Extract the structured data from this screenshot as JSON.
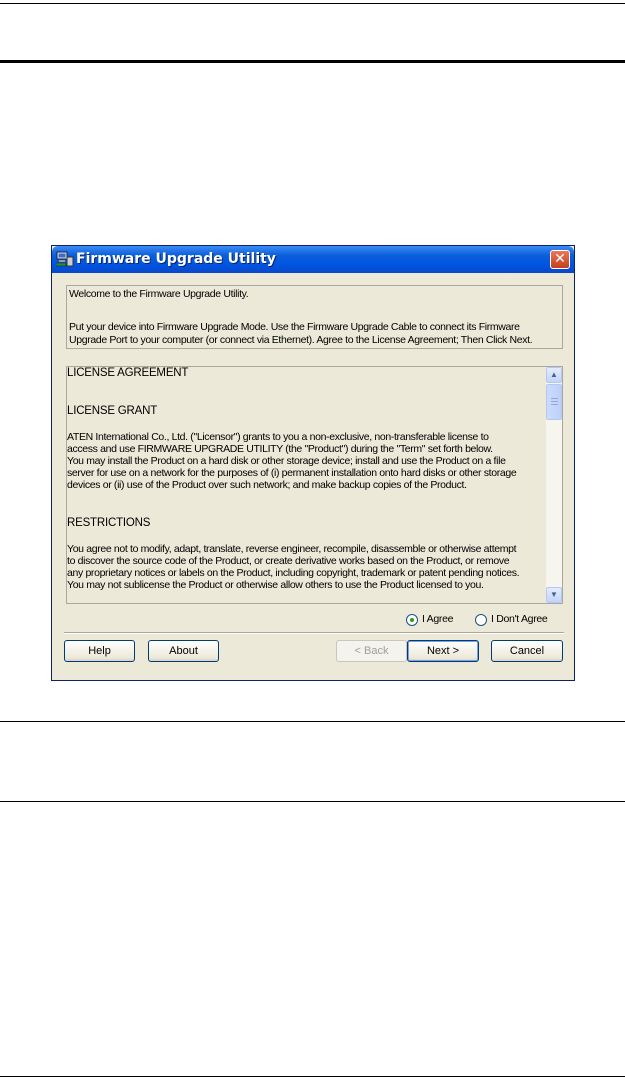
{
  "window": {
    "title": "Firmware Upgrade Utility",
    "close_symbol": "✕"
  },
  "welcome": {
    "line1": "Welcome to the Firmware Upgrade Utility.",
    "line2": "Put your device into Firmware Upgrade Mode. Use the Firmware Upgrade Cable to connect its Firmware",
    "line3": "Upgrade Port to your computer (or connect via Ethernet). Agree to the License Agreement; Then Click Next."
  },
  "license": {
    "heading": "LICENSE AGREEMENT",
    "grant_heading": "LICENSE GRANT",
    "grant_lines": [
      "ATEN International Co., Ltd. (\"Licensor\") grants to you a non-exclusive, non-transferable license to",
      "access and use FIRMWARE UPGRADE UTILITY (the \"Product\") during the \"Term\" set forth below.",
      "You may install the Product on a hard disk or other storage device; install and use the Product on a file",
      "server for use on a network for the purposes of (i) permanent installation onto hard disks or other storage",
      "devices or (ii) use of the Product over such network; and make backup copies of the Product."
    ],
    "restrictions_heading": "RESTRICTIONS",
    "restriction_lines": [
      "You agree not to modify, adapt, translate, reverse engineer, recompile, disassemble or otherwise attempt",
      "to discover the source code of the Product, or create derivative works based on the Product, or remove",
      "any proprietary notices or labels on the Product, including copyright, trademark or patent pending notices.",
      "You may not sublicense the Product or otherwise allow others to use the Product licensed to you."
    ]
  },
  "agreement": {
    "agree_label": "I Agree",
    "disagree_label": "I Don't Agree",
    "selected": "agree"
  },
  "buttons": {
    "help": "Help",
    "about": "About",
    "back": "< Back",
    "next": "Next >",
    "cancel": "Cancel"
  },
  "colors": {
    "titlebar": "#0054e3",
    "dialog_bg": "#ece9d8",
    "close_button": "#c4401c"
  },
  "icons": {
    "app": "computer-network-icon",
    "close": "close-icon",
    "scroll_up": "arrow-up-icon",
    "scroll_down": "arrow-down-icon"
  }
}
